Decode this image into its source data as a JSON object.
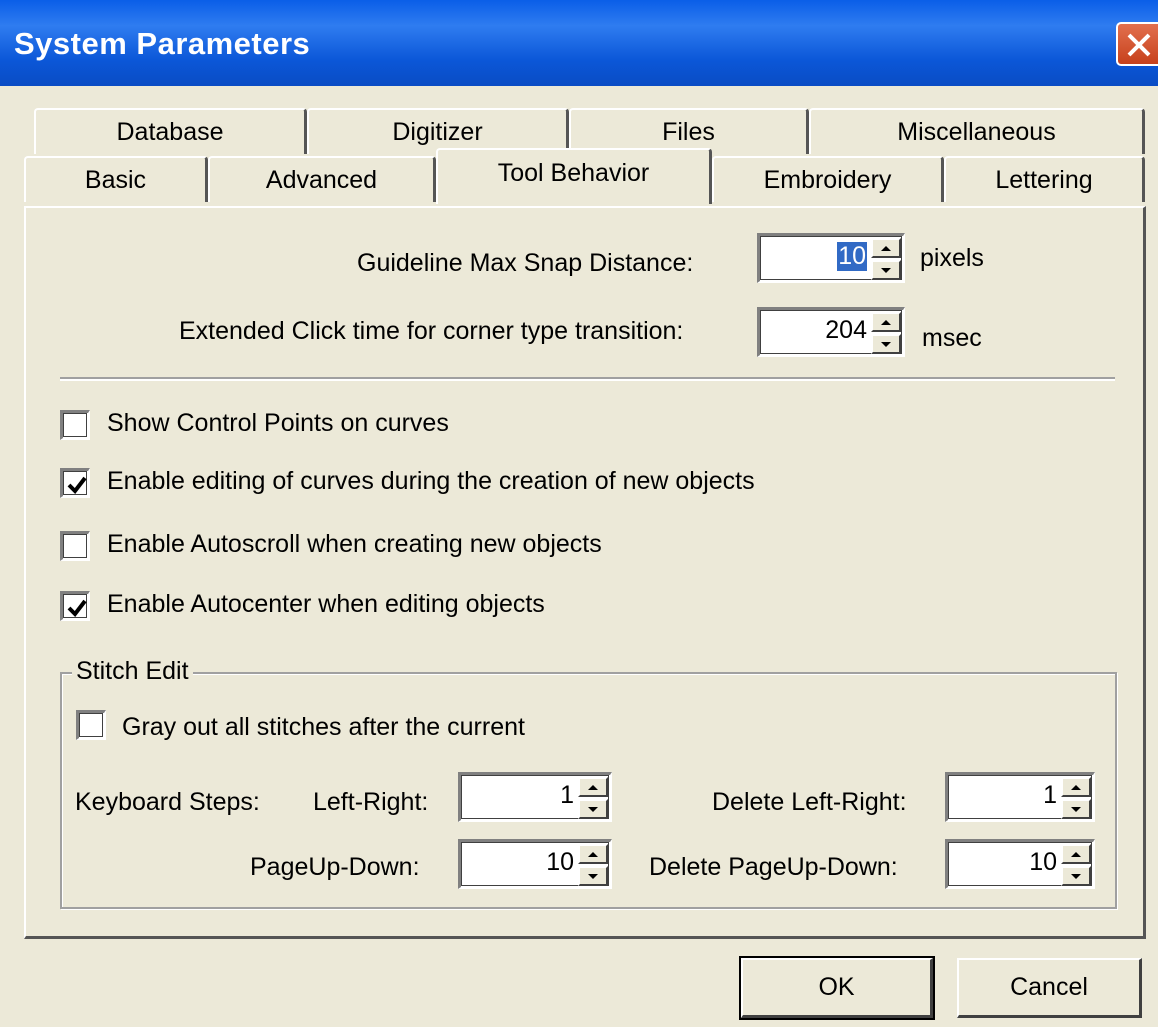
{
  "window": {
    "title": "System Parameters",
    "close_icon": "close-icon"
  },
  "tabs": {
    "row1": [
      "Database",
      "Digitizer",
      "Files",
      "Miscellaneous"
    ],
    "row2": [
      "Basic",
      "Advanced",
      "Tool Behavior",
      "Embroidery",
      "Lettering"
    ],
    "selected": "Tool Behavior"
  },
  "snap": {
    "label": "Guideline Max Snap Distance:",
    "value": "10",
    "unit": "pixels"
  },
  "click": {
    "label": "Extended Click time for corner type transition:",
    "value": "204",
    "unit": "msec"
  },
  "options": [
    {
      "label": "Show Control Points on curves",
      "checked": false
    },
    {
      "label": "Enable editing of curves during the creation of new objects",
      "checked": true
    },
    {
      "label": "Enable Autoscroll when creating new objects",
      "checked": false
    },
    {
      "label": "Enable Autocenter when editing objects",
      "checked": true
    }
  ],
  "stitch_edit": {
    "title": "Stitch Edit",
    "gray_out": {
      "label": "Gray out all stitches after the current",
      "checked": false
    },
    "keyboard_steps_label": "Keyboard Steps:",
    "left_right": {
      "label": "Left-Right:",
      "value": "1"
    },
    "pageup_down": {
      "label": "PageUp-Down:",
      "value": "10"
    },
    "delete_left_right": {
      "label": "Delete Left-Right:",
      "value": "1"
    },
    "delete_pageup_down": {
      "label": "Delete PageUp-Down:",
      "value": "10"
    }
  },
  "buttons": {
    "ok": "OK",
    "cancel": "Cancel"
  },
  "colors": {
    "titlebar": "#0a5ee8",
    "face": "#ece9d8",
    "selection": "#316ac5"
  }
}
